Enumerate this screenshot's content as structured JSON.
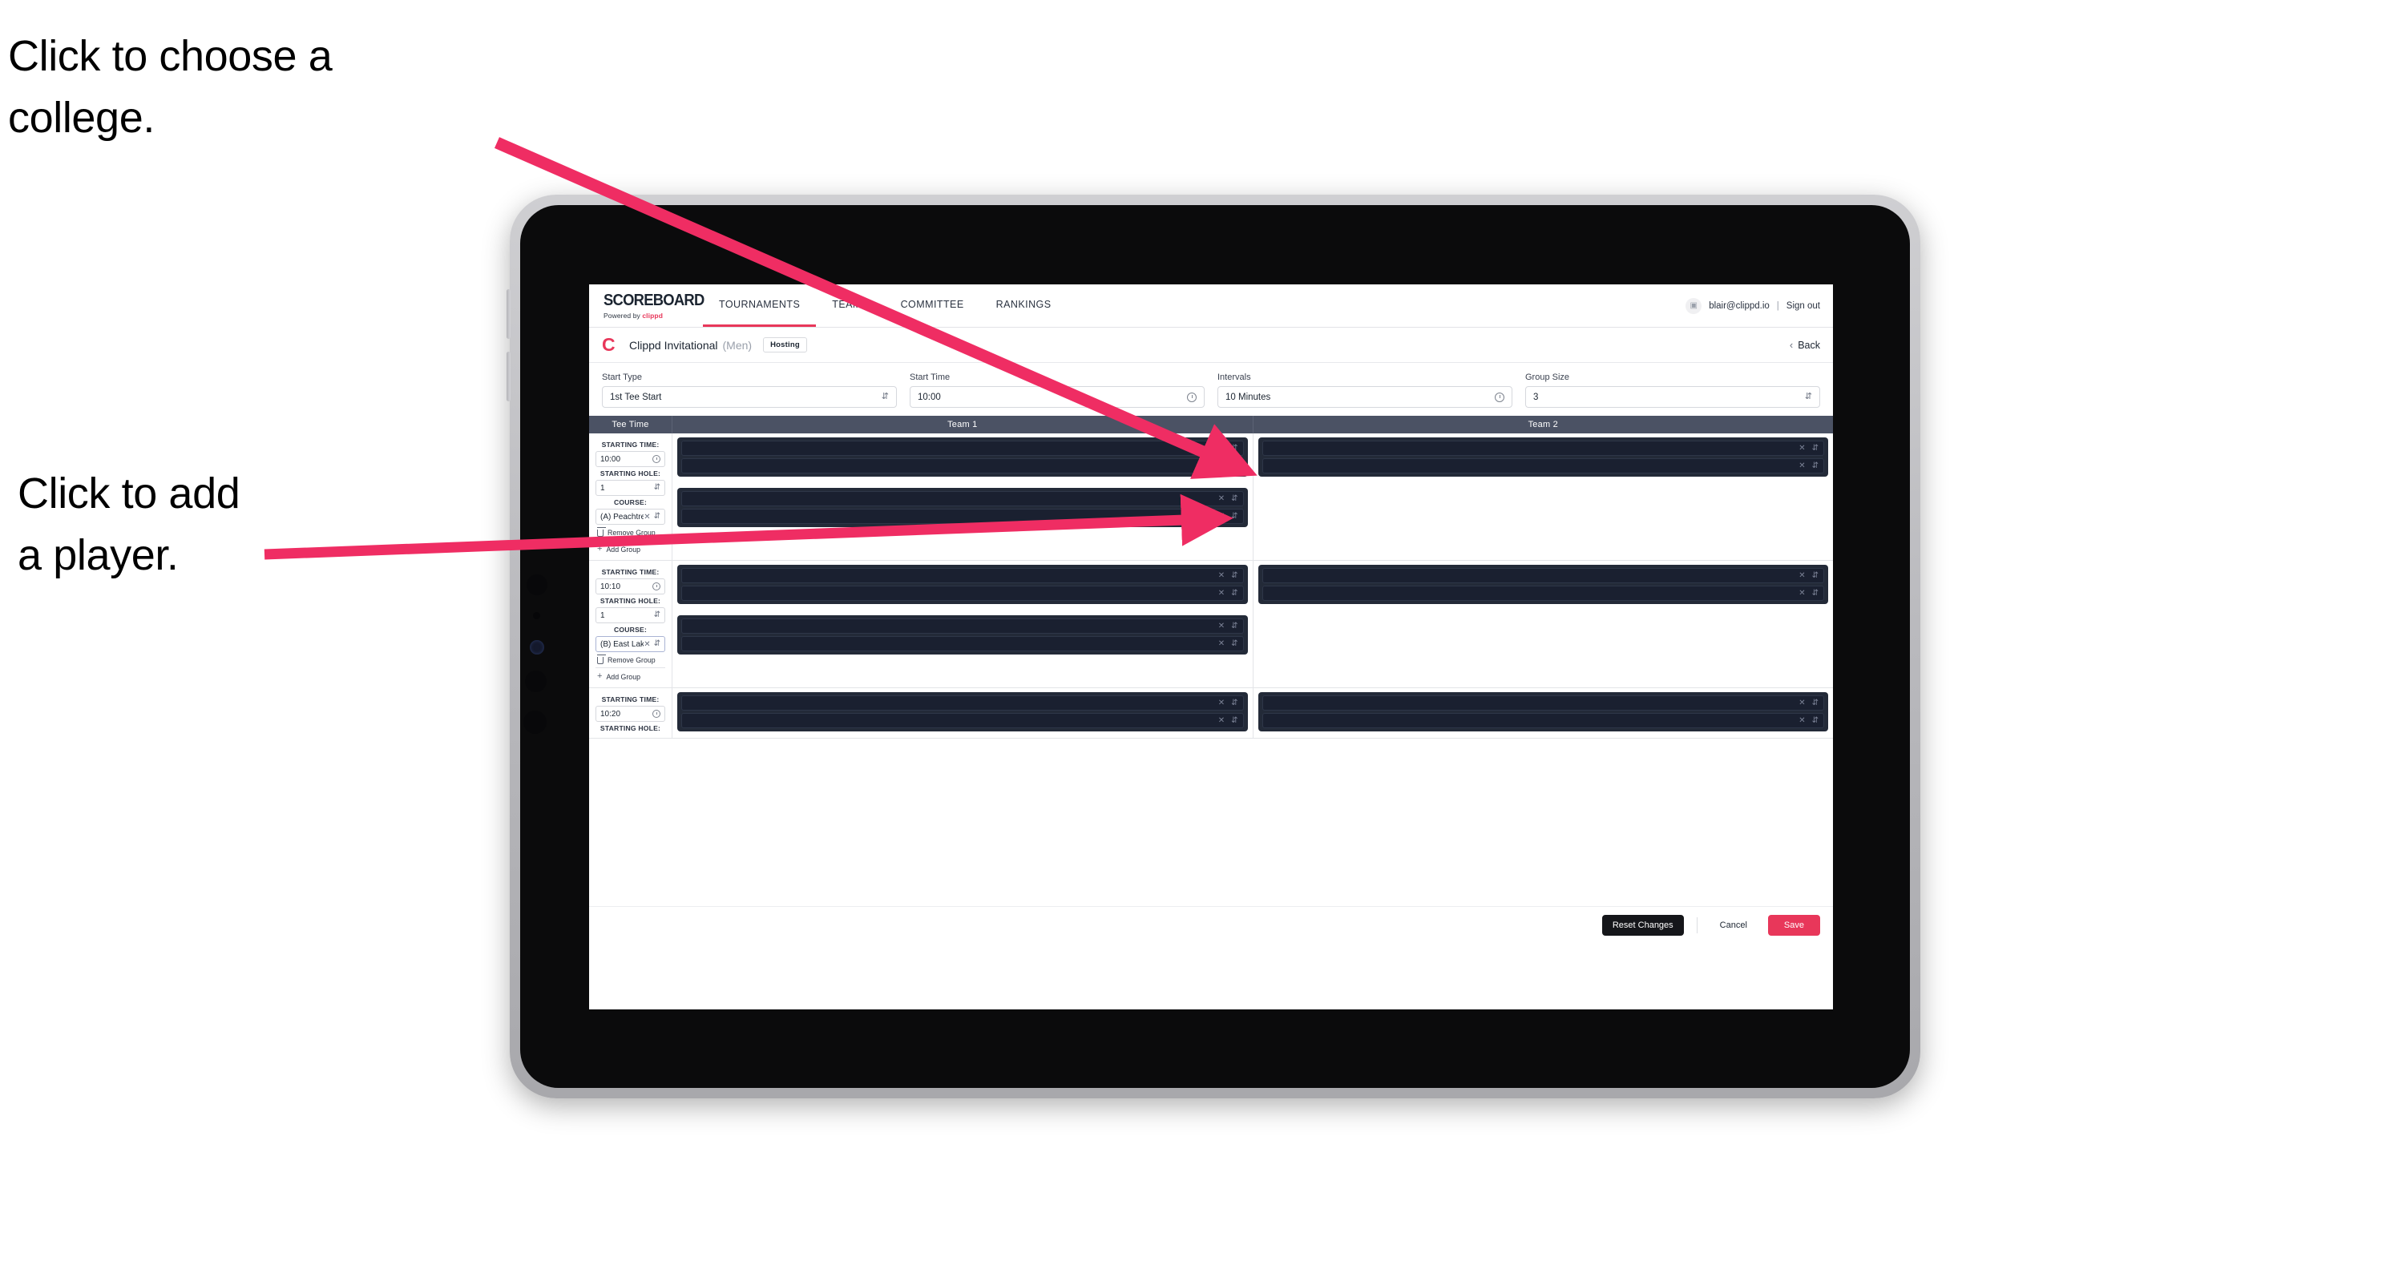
{
  "annotations": {
    "college": "Click to choose a\ncollege.",
    "player": "Click to add\na player."
  },
  "colors": {
    "accent": "#e8375a",
    "header_bar": "#4b5264",
    "player_card": "#232a38",
    "player_row": "#1a2030",
    "dark_button": "#15161a"
  },
  "app": {
    "brand": {
      "word": "SCOREBOARD",
      "powered_prefix": "Powered by ",
      "powered_name": "clippd"
    },
    "nav": [
      {
        "label": "TOURNAMENTS",
        "active": true
      },
      {
        "label": "TEAMS",
        "active": false
      },
      {
        "label": "COMMITTEE",
        "active": false
      },
      {
        "label": "RANKINGS",
        "active": false
      }
    ],
    "account": {
      "avatar_icon": "user-avatar-icon",
      "email": "blair@clippd.io",
      "separator": "|",
      "signout": "Sign out"
    },
    "tournament": {
      "logo": "C",
      "name": "Clippd Invitational",
      "gender": "(Men)",
      "badge": "Hosting",
      "back": "Back",
      "back_icon": "chevron-left-icon"
    },
    "settings": [
      {
        "label": "Start Type",
        "value": "1st Tee Start",
        "icon": "stepper-icon"
      },
      {
        "label": "Start Time",
        "value": "10:00",
        "icon": "clock-icon"
      },
      {
        "label": "Intervals",
        "value": "10 Minutes",
        "icon": "clock-icon"
      },
      {
        "label": "Group Size",
        "value": "3",
        "icon": "stepper-icon"
      }
    ],
    "table": {
      "headers": [
        "Tee Time",
        "Team 1",
        "Team 2"
      ],
      "labels": {
        "starting_time": "STARTING TIME:",
        "starting_hole": "STARTING HOLE:",
        "course": "COURSE:",
        "remove_group": "Remove Group",
        "add_group": "Add Group"
      },
      "groups": [
        {
          "time": "10:00",
          "hole": "1",
          "course": "(A) Peachtree GC",
          "course_focused": false,
          "team1_cards": 2,
          "team2_cards": 1,
          "rows_per_card": 2
        },
        {
          "time": "10:10",
          "hole": "1",
          "course": "(B) East Lake GC",
          "course_focused": true,
          "team1_cards": 2,
          "team2_cards": 1,
          "rows_per_card": 2
        },
        {
          "time": "10:20",
          "hole": "",
          "course": "",
          "course_focused": false,
          "team1_cards": 1,
          "team2_cards": 1,
          "rows_per_card": 2
        }
      ]
    },
    "footer": {
      "reset": "Reset Changes",
      "cancel": "Cancel",
      "save": "Save"
    }
  }
}
